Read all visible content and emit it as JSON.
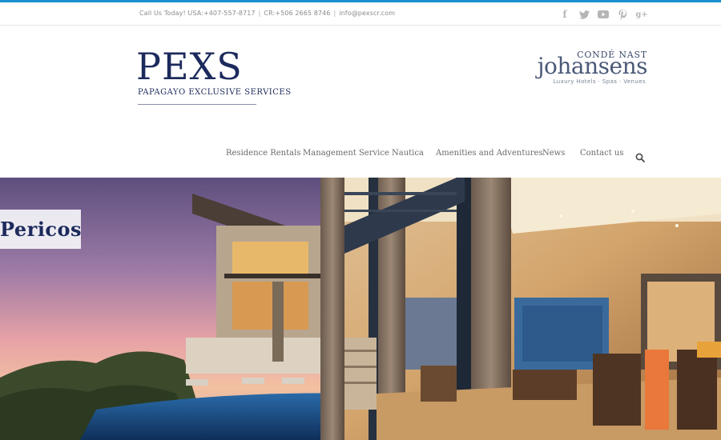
{
  "topbar": {
    "phone_text": "Call Us Today! USA:+407-557-8717",
    "separator": "|",
    "cr_text": "CR:+506 2665 8746",
    "email_text": "info@pexscr.com",
    "social_icons": [
      "facebook-icon",
      "twitter-icon",
      "youtube-icon",
      "pinterest-icon",
      "googleplus-icon"
    ],
    "facebook_glyph": "f",
    "googleplus_glyph": "g+"
  },
  "logo": {
    "main": "PEXS",
    "subtitle": "PAPAGAYO EXCLUSIVE SERVICES"
  },
  "partner": {
    "top": "CONDÉ NAST",
    "main": "johansens",
    "tagline": "Luxury Hotels · Spas · Venues"
  },
  "nav": {
    "items": [
      "Residence Rentals",
      "Management Service",
      "Nautica",
      "Amenities and Adventures",
      "News",
      "Contact us"
    ]
  },
  "hero": {
    "caption": "Pericos"
  },
  "colors": {
    "accent": "#1a8fd0",
    "brand_navy": "#1c2a5c",
    "nav_text": "#6a6a6a"
  }
}
